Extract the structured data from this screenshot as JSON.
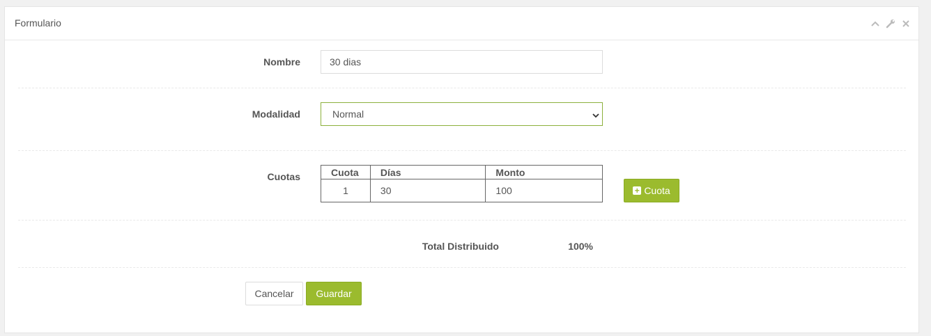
{
  "panel": {
    "title": "Formulario",
    "tools": [
      "chevron-up-icon",
      "wrench-icon",
      "close-icon"
    ]
  },
  "form": {
    "nombre": {
      "label": "Nombre",
      "value": "30 dias"
    },
    "modalidad": {
      "label": "Modalidad",
      "selected": "Normal"
    },
    "cuotas": {
      "label": "Cuotas",
      "headers": [
        "Cuota",
        "Días",
        "Monto"
      ],
      "rows": [
        {
          "cuota": "1",
          "dias": "30",
          "monto": "100"
        }
      ],
      "add_button": "Cuota"
    },
    "total": {
      "label": "Total Distribuido",
      "value": "100%"
    },
    "actions": {
      "cancel": "Cancelar",
      "save": "Guardar"
    }
  },
  "colors": {
    "accent": "#9bbb2e",
    "select_border": "#8cb03c"
  }
}
